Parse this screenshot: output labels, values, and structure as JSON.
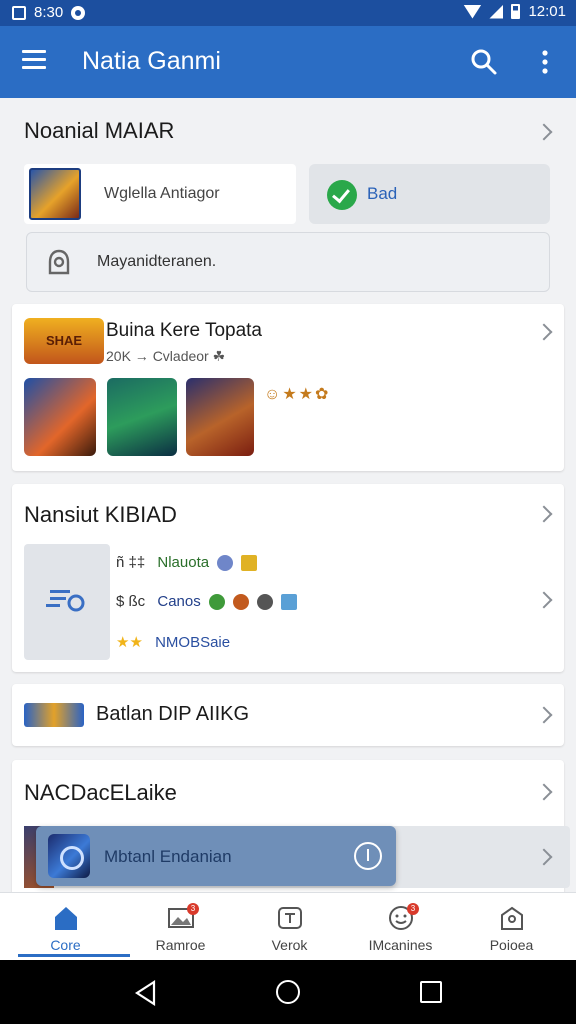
{
  "status_bar": {
    "time_left": "8:30",
    "time_right": "12:01"
  },
  "app_bar": {
    "title": "Natia Ganmi"
  },
  "section1": {
    "title": "Noanial MAIAR",
    "tile_label": "Wglella Antiagor",
    "chip_label": "Bad",
    "input_placeholder": "Mayanidteranen."
  },
  "card2": {
    "logo_text": "SHAE",
    "title": "Buina Kere Topata",
    "meta": "20K → Cvladeor ☘",
    "emojis": "☺★★✿"
  },
  "card3": {
    "title": "Nansiut KIBIAD",
    "rows": [
      {
        "sym": "ñ ‡‡",
        "text": "Nlauota"
      },
      {
        "sym": "$ ßc",
        "text": "Canos"
      },
      {
        "sym": "★★",
        "text": "NMOBSaie"
      }
    ]
  },
  "card4": {
    "title": "Batlan DIP AIIKG"
  },
  "card5": {
    "title": "NACDacELaike"
  },
  "snackbar": {
    "label": "Mbtanl Endanian"
  },
  "bottom_nav": [
    {
      "label": "Core",
      "icon": "home-icon",
      "active": true
    },
    {
      "label": "Ramroe",
      "icon": "image-icon",
      "badge": "3"
    },
    {
      "label": "Verok",
      "icon": "tv-icon"
    },
    {
      "label": "IMcanines",
      "icon": "face-icon",
      "badge": "3"
    },
    {
      "label": "Poioea",
      "icon": "profile-icon"
    }
  ],
  "colors": {
    "primary": "#2b6dc4",
    "status_bar": "#1c4f9f",
    "accent_green": "#2aa84a"
  }
}
